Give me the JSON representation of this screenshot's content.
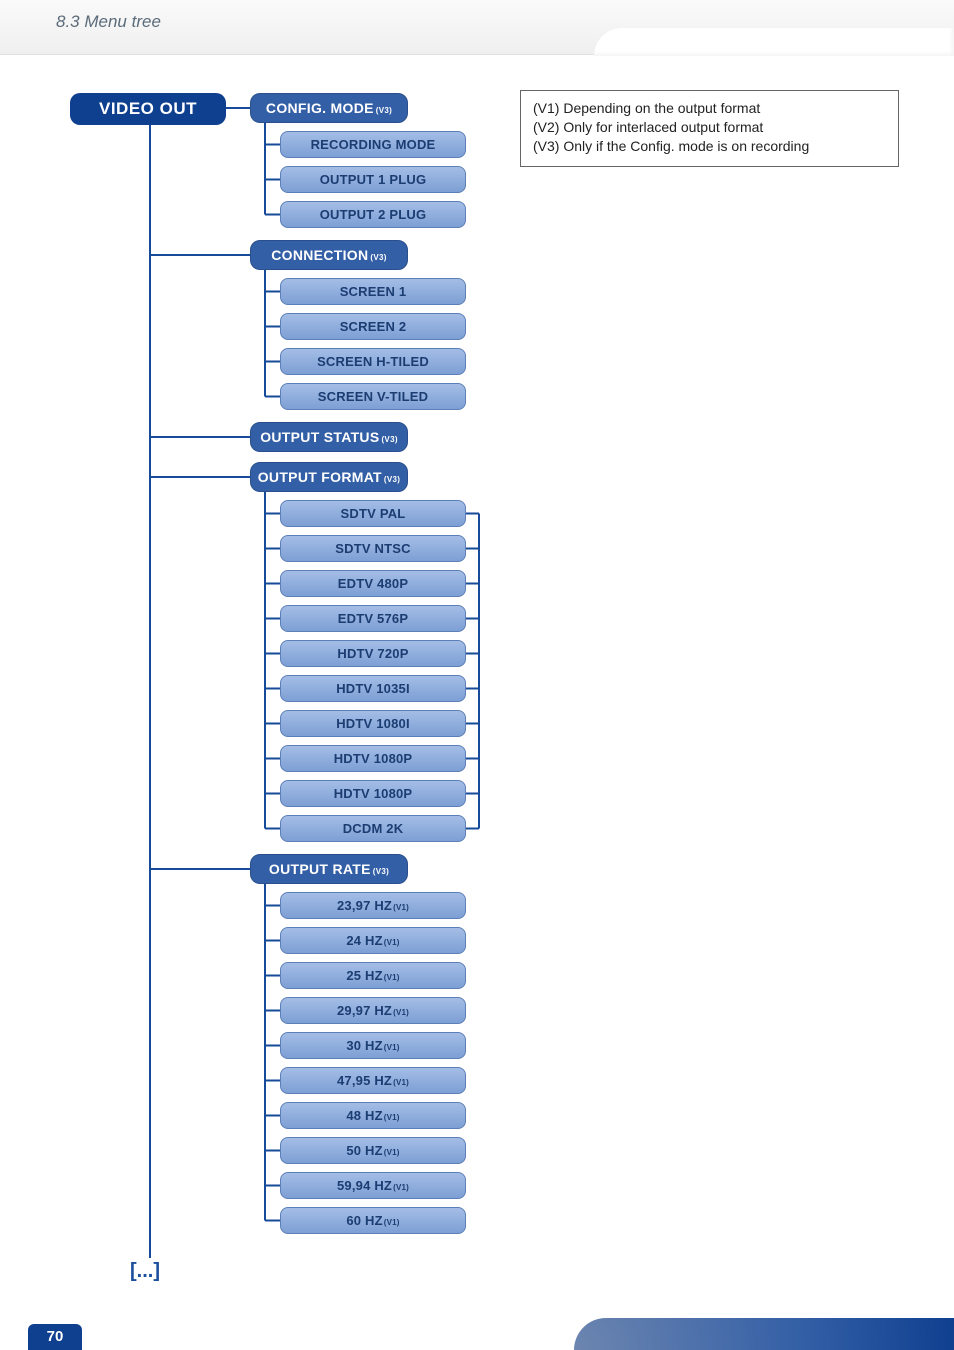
{
  "header": {
    "section_title": "8.3 Menu tree"
  },
  "root": {
    "label": "VIDEO OUT"
  },
  "categories": [
    {
      "label": "CONFIG. MODE",
      "sup": "(V3)",
      "leaves": [
        {
          "label": "RECORDING MODE"
        },
        {
          "label": "OUTPUT 1 PLUG"
        },
        {
          "label": "OUTPUT 2 PLUG"
        }
      ]
    },
    {
      "label": "CONNECTION",
      "sup": "(V3)",
      "leaves": [
        {
          "label": "SCREEN 1"
        },
        {
          "label": "SCREEN 2"
        },
        {
          "label": "SCREEN H-TILED"
        },
        {
          "label": "SCREEN V-TILED"
        }
      ]
    },
    {
      "label": "OUTPUT STATUS",
      "sup": "(V3)",
      "leaves": []
    },
    {
      "label": "OUTPUT FORMAT",
      "sup": "(V3)",
      "right_connect": true,
      "leaves": [
        {
          "label": "SDTV PAL"
        },
        {
          "label": "SDTV NTSC"
        },
        {
          "label": "EDTV 480P"
        },
        {
          "label": "EDTV 576P"
        },
        {
          "label": "HDTV 720P"
        },
        {
          "label": "HDTV 1035I"
        },
        {
          "label": "HDTV 1080I"
        },
        {
          "label": "HDTV 1080P"
        },
        {
          "label": "HDTV 1080P"
        },
        {
          "label": "DCDM 2K"
        }
      ]
    },
    {
      "label": "OUTPUT RATE",
      "sup": "(V3)",
      "leaves": [
        {
          "label": "23,97 HZ",
          "sup": "(V1)"
        },
        {
          "label": "24 HZ",
          "sup": "(V1)"
        },
        {
          "label": "25 HZ",
          "sup": "(V1)"
        },
        {
          "label": "29,97 HZ",
          "sup": "(V1)"
        },
        {
          "label": "30 HZ",
          "sup": "(V1)"
        },
        {
          "label": "47,95 HZ",
          "sup": "(V1)"
        },
        {
          "label": "48 HZ",
          "sup": "(V1)"
        },
        {
          "label": "50 HZ",
          "sup": "(V1)"
        },
        {
          "label": "59,94 HZ",
          "sup": "(V1)"
        },
        {
          "label": "60 HZ",
          "sup": "(V1)"
        }
      ]
    }
  ],
  "continuation": "[...]",
  "notes": [
    "(V1) Depending on the output format",
    "(V2) Only for interlaced output format",
    "(V3) Only if the Config. mode is on recording"
  ],
  "footer": {
    "page_number": "70"
  }
}
